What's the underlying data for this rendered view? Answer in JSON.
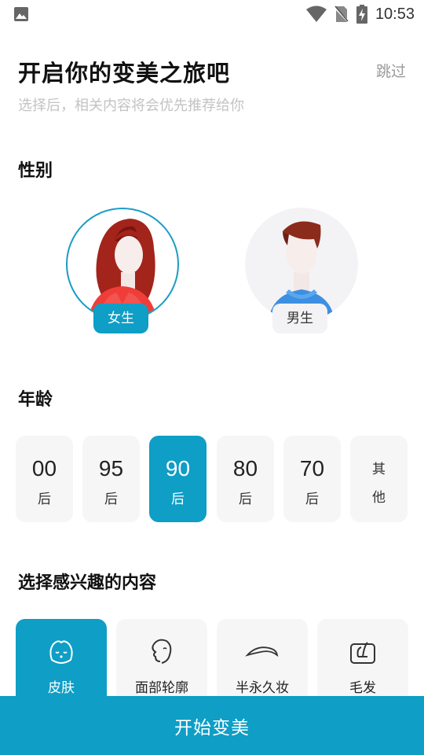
{
  "status_bar": {
    "time": "10:53",
    "icons": [
      "image-icon",
      "wifi-icon",
      "no-sim-icon",
      "battery-charging-icon"
    ]
  },
  "header": {
    "title": "开启你的变美之旅吧",
    "skip_label": "跳过",
    "subtitle": "选择后，相关内容将会优先推荐给你"
  },
  "gender": {
    "title": "性别",
    "options": [
      {
        "label": "女生",
        "selected": true,
        "icon": "female-avatar-icon"
      },
      {
        "label": "男生",
        "selected": false,
        "icon": "male-avatar-icon"
      }
    ]
  },
  "age": {
    "title": "年龄",
    "options": [
      {
        "num": "00",
        "suffix": "后",
        "selected": false
      },
      {
        "num": "95",
        "suffix": "后",
        "selected": false
      },
      {
        "num": "90",
        "suffix": "后",
        "selected": true
      },
      {
        "num": "80",
        "suffix": "后",
        "selected": false
      },
      {
        "num": "70",
        "suffix": "后",
        "selected": false
      },
      {
        "line1": "其",
        "line2": "他",
        "selected": false
      }
    ]
  },
  "interests": {
    "title": "选择感兴趣的内容",
    "options": [
      {
        "label": "皮肤",
        "selected": true,
        "icon": "skin-face-icon"
      },
      {
        "label": "面部轮廓",
        "selected": false,
        "icon": "face-contour-icon"
      },
      {
        "label": "半永久妆",
        "selected": false,
        "icon": "eyebrow-icon"
      },
      {
        "label": "毛发",
        "selected": false,
        "icon": "hair-icon"
      }
    ]
  },
  "footer": {
    "start_label": "开始变美"
  },
  "colors": {
    "accent": "#0e9ec6",
    "card_bg": "#f6f6f7"
  }
}
